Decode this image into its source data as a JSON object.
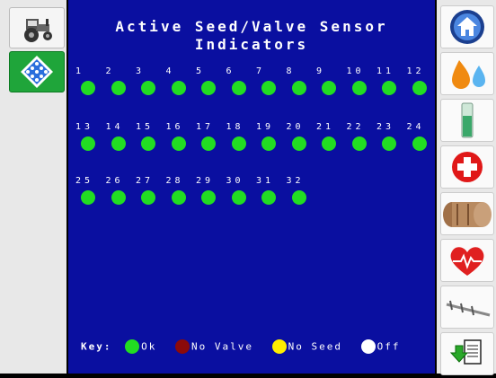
{
  "title": {
    "line1": "Active Seed/Valve Sensor",
    "line2": "Indicators"
  },
  "rows": [
    [
      "1",
      "2",
      "3",
      "4",
      "5",
      "6",
      "7",
      "8",
      "9",
      "10",
      "11",
      "12"
    ],
    [
      "13",
      "14",
      "15",
      "16",
      "17",
      "18",
      "19",
      "20",
      "21",
      "22",
      "23",
      "24"
    ],
    [
      "25",
      "26",
      "27",
      "28",
      "29",
      "30",
      "31",
      "32"
    ]
  ],
  "key": {
    "label": "Key:",
    "ok": "Ok",
    "no_valve": "No Valve",
    "no_seed": "No Seed",
    "off": "Off"
  },
  "colors": {
    "ok": "#22dd22",
    "no_valve": "#8b0a0a",
    "no_seed": "#ffee00",
    "off": "#ffffff",
    "background": "#0a0fa0"
  },
  "left_nav": [
    "tractor-icon",
    "sensor-grid-icon"
  ],
  "right_nav": [
    "home-icon",
    "fluids-icon",
    "tank-icon",
    "health-icon",
    "rollers-icon",
    "heart-monitor-icon",
    "calibration-icon",
    "export-icon"
  ]
}
